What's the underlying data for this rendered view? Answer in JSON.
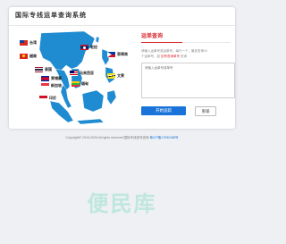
{
  "header": {
    "title": "国际专线运单查询系统"
  },
  "countries": [
    {
      "label": "台湾"
    },
    {
      "label": "越南"
    },
    {
      "label": "老挝"
    },
    {
      "label": "菲律宾"
    },
    {
      "label": "泰国"
    },
    {
      "label": "马来西亚"
    },
    {
      "label": "柬埔寨"
    },
    {
      "label": "缅甸"
    },
    {
      "label": "文莱"
    },
    {
      "label": "新加坡"
    },
    {
      "label": "印尼"
    }
  ],
  "query": {
    "title": "运单查询",
    "hint_prefix": "请输入运单号或运单号，每行一个，最多查询10",
    "hint_middle": "个运单号，如",
    "hint_red": "如号查询单号",
    "hint_suffix": "查询",
    "placeholder": "请输入运单号或单号",
    "submit_label": "开始追踪",
    "reset_label": "重输"
  },
  "footer": {
    "copyright": "Copyright© 2016-2026  All rights reserved  国际专线查号查询",
    "link": "粤ICP备17050188号"
  },
  "watermark": "便民库",
  "colors": {
    "accent": "#d8252c",
    "primary": "#1a73d9",
    "map": "#1f8bd0"
  }
}
